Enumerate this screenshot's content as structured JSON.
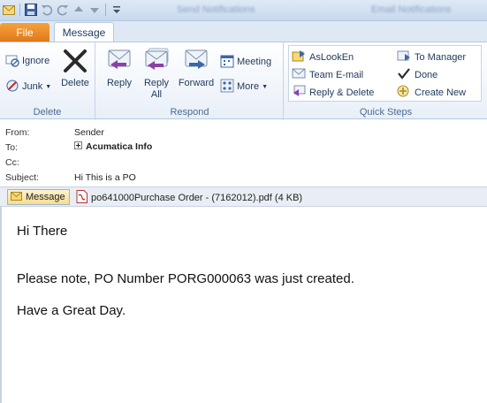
{
  "window": {
    "title": "Send Notifications",
    "title_right": "Email Notifications"
  },
  "tabs": {
    "file": "File",
    "message": "Message"
  },
  "ribbon": {
    "delete_group": {
      "label": "Delete",
      "ignore": "Ignore",
      "junk": "Junk",
      "delete": "Delete"
    },
    "respond_group": {
      "label": "Respond",
      "reply": "Reply",
      "reply_all": "Reply All",
      "forward": "Forward",
      "meeting": "Meeting",
      "more": "More"
    },
    "quick_steps": {
      "label": "Quick Steps",
      "items": [
        "AsLookEn",
        "To Manager",
        "Team E-mail",
        "Done",
        "Reply & Delete",
        "Create New"
      ]
    }
  },
  "header": {
    "from_label": "From:",
    "from_value": "Sender",
    "to_label": "To:",
    "to_value": "Acumatica Info",
    "cc_label": "Cc:",
    "cc_value": "",
    "subject_label": "Subject:",
    "subject_value": "Hi This is a PO"
  },
  "attachments": {
    "message_label": "Message",
    "file_name": "po641000Purchase Order - (7162012).pdf (4 KB)"
  },
  "body": {
    "greeting": "Hi There",
    "line1": "Please note, PO Number PORG000063 was just created.",
    "line2": "Have a Great Day."
  },
  "colors": {
    "file_tab": "#e0761a",
    "ribbon_text": "#1e395b",
    "accent": "#4a6a92"
  }
}
